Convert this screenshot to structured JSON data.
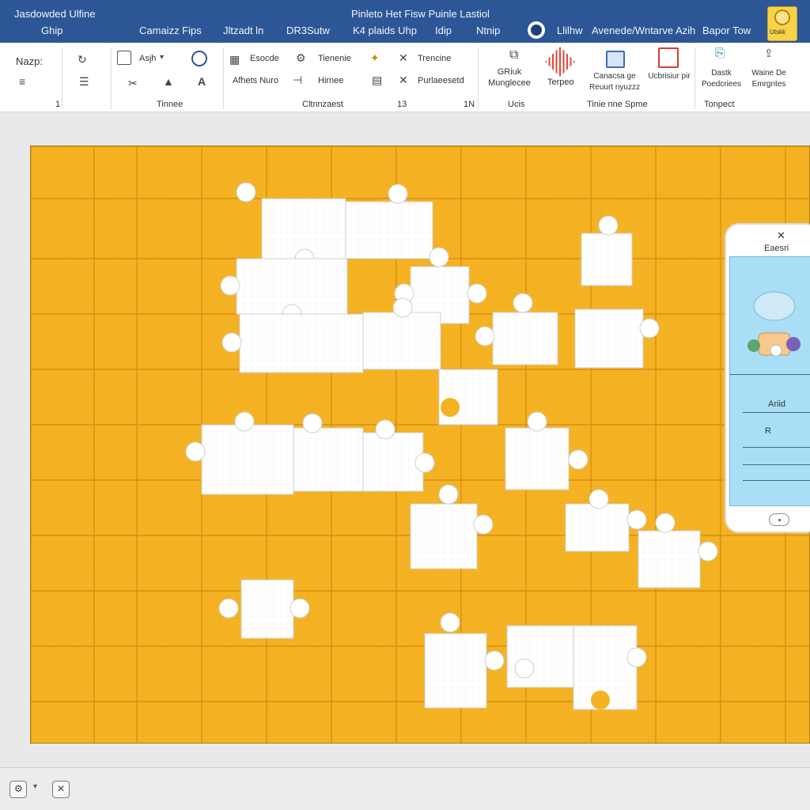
{
  "window": {
    "app_name": "Jasdowded Ulfine",
    "doc_title": "Pinleto Het Fisw Puinle Lastiol",
    "search_hint": "Avenede/Wntarve Azih",
    "account": "Bapor Tow",
    "logo_text": "Utskk"
  },
  "menu_tabs": [
    {
      "label": "Ghip"
    },
    {
      "label": "Camaizz Fips"
    },
    {
      "label": "Jltzadt ln"
    },
    {
      "label": "DR3Sutw"
    },
    {
      "label": "K4 plaids Uhp"
    },
    {
      "label": "Idip"
    },
    {
      "label": "Ntnip"
    },
    {
      "label": "Llilhw"
    }
  ],
  "ribbon": {
    "g1": {
      "label": "Nazp:",
      "footer": "1"
    },
    "g2": {
      "font_name": "Asjh",
      "footer": "Tinnee"
    },
    "g3": {
      "row1_a": "Esocde",
      "row1_b": "Tienenie",
      "row1_c": "Trencine",
      "row2_a": "Afhets Nuro",
      "row2_b": "Hirnee",
      "row2_c": "Purlaeesetd",
      "footer": "Cltnnzaest",
      "footer_num": "13",
      "footer_num2": "1N"
    },
    "g4": {
      "btn1": "GRiuk Munglecee",
      "footer": "Ucis"
    },
    "g5": {
      "btn1": "Terpeo",
      "btn2": "Canacsa ge Reuurt nyuzzz",
      "btn3": "Ucbrisiur pir",
      "footer": "Tinie nne Spme"
    },
    "g6": {
      "btn1": "Dastk Poedcriees",
      "btn2": "Waine De Emrgntes",
      "footer": "Tonpect"
    }
  },
  "side_panel": {
    "title": "Eaesri",
    "field1": "Ariid",
    "field2": "R"
  },
  "colors": {
    "board": "#f5b323",
    "grid_line": "#d98e12",
    "piece": "#ffffff",
    "titlebar": "#2d5697"
  },
  "icons": {
    "scissors": "scissors-icon",
    "star": "star-icon",
    "image": "image-icon",
    "fill": "fill-icon"
  }
}
